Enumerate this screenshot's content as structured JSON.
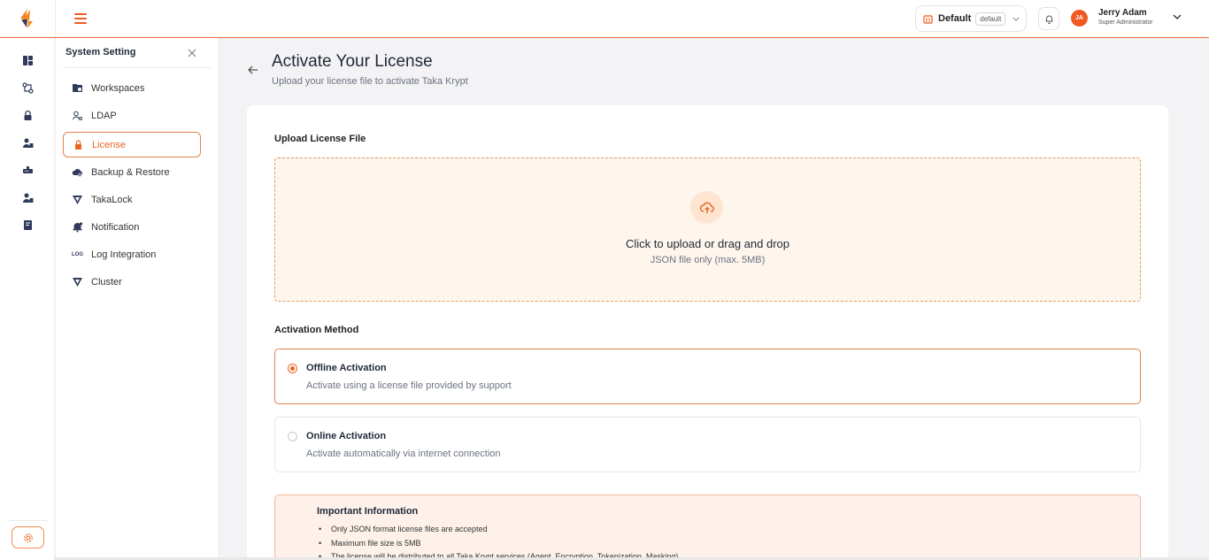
{
  "header": {
    "workspace_name": "Default",
    "workspace_badge": "default",
    "user_initials": "JA",
    "user_name": "Jerry Adam",
    "user_role": "Super Administrator"
  },
  "rail": {
    "icons": [
      "dashboard-icon",
      "flow-icon",
      "lock-icon",
      "users-icon",
      "server-icon",
      "user-settings-icon",
      "report-icon"
    ],
    "settings_icon": "gear-icon"
  },
  "panel": {
    "title": "System Setting",
    "items": [
      {
        "label": "Workspaces",
        "icon": "workspace-icon"
      },
      {
        "label": "LDAP",
        "icon": "ldap-icon"
      },
      {
        "label": "License",
        "icon": "lock-icon",
        "active": true
      },
      {
        "label": "Backup & Restore",
        "icon": "cloud-icon"
      },
      {
        "label": "TakaLock",
        "icon": "takalock-icon"
      },
      {
        "label": "Notification",
        "icon": "bell-icon"
      },
      {
        "label": "Log Integration",
        "icon": "log-icon",
        "icon_text": "LOG"
      },
      {
        "label": "Cluster",
        "icon": "cluster-icon"
      }
    ]
  },
  "main": {
    "title": "Activate Your License",
    "subtitle": "Upload your license file to activate Taka Krypt",
    "upload_label": "Upload License File",
    "dropzone_title": "Click to upload or drag and drop",
    "dropzone_hint": "JSON file only (max. 5MB)",
    "activation_label": "Activation Method",
    "options": [
      {
        "title": "Offline Activation",
        "desc": "Activate using a license file provided by support",
        "selected": true
      },
      {
        "title": "Online Activation",
        "desc": "Activate automatically via internet connection",
        "selected": false
      }
    ],
    "info": {
      "title": "Important Information",
      "items": [
        "Only JSON format license files are accepted",
        "Maximum file size is 5MB",
        "The license will be distributed to all Taka Krypt services (Agent, Encryption, Tokenization, Masking)"
      ]
    }
  },
  "colors": {
    "accent": "#e8661f",
    "brand_orange": "#f05a22",
    "dropzone_bg": "#fef5ec",
    "info_bg": "#fdf1ea"
  }
}
